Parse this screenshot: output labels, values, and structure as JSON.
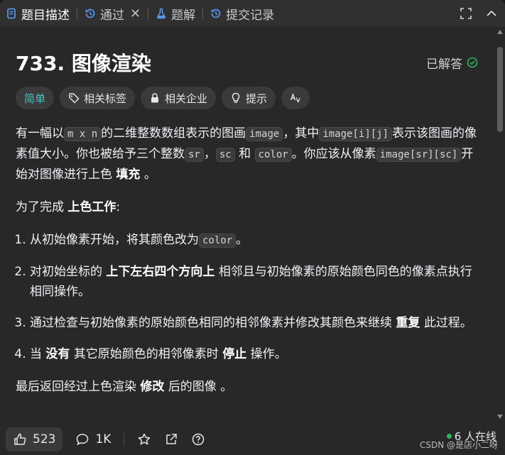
{
  "tabs": [
    {
      "label": "题目描述",
      "icon": "description-icon",
      "active": true
    },
    {
      "label": "通过",
      "icon": "history-icon",
      "active": false,
      "closable": true
    },
    {
      "label": "题解",
      "icon": "flask-icon",
      "active": false
    },
    {
      "label": "提交记录",
      "icon": "history-icon",
      "active": false
    }
  ],
  "title": "733. 图像渲染",
  "status": "已解答",
  "tags": [
    {
      "label": "简单",
      "icon": ""
    },
    {
      "label": "相关标签",
      "icon": "tag-icon"
    },
    {
      "label": "相关企业",
      "icon": "lock-icon"
    },
    {
      "label": "提示",
      "icon": "lightbulb-icon"
    },
    {
      "label": "",
      "icon": "translate-icon"
    }
  ],
  "desc": {
    "p1": {
      "t1": "有一幅以",
      "c1": "m x n",
      "t2": "的二维整数数组表示的图画",
      "c2": "image",
      "t3": "，其中",
      "c3": "image[i][j]",
      "t4": "表示该图画的像素值大小。你也被给予三个整数",
      "c4": "sr",
      "t5": "，",
      "c5": "sc",
      "t6": "和",
      "c6": "color",
      "t7": "。你应该从像素",
      "c7": "image[sr][sc]",
      "t8": "开始对图像进行上色",
      "b1": "填充",
      "t9": "。"
    },
    "p2": {
      "t1": "为了完成",
      "b1": "上色工作",
      "t2": ":"
    },
    "li1": {
      "t1": "从初始像素开始，将其颜色改为",
      "c1": "color",
      "t2": "。"
    },
    "li2": {
      "t1": "对初始坐标的",
      "b1": "上下左右四个方向上",
      "t2": "相邻且与初始像素的原始颜色同色的像素点执行相同操作。"
    },
    "li3": {
      "t1": "通过检查与初始像素的原始颜色相同的相邻像素并修改其颜色来继续",
      "b1": "重复",
      "t2": "此过程。"
    },
    "li4": {
      "t1": "当",
      "b1": "没有",
      "t2": "其它原始颜色的相邻像素时",
      "b2": "停止",
      "t3": "操作。"
    },
    "p3": {
      "t1": "最后返回经过上色渲染",
      "b1": "修改",
      "t2": "后的图像",
      "t3": "。"
    }
  },
  "bottom": {
    "likes": "523",
    "comments": "1K",
    "online": "6 人在线"
  },
  "watermark": "CSDN @是店小二呀",
  "colors": {
    "easy": "#46c6c2",
    "online_dot": "#2db55d",
    "solved_check": "#2db55d"
  }
}
